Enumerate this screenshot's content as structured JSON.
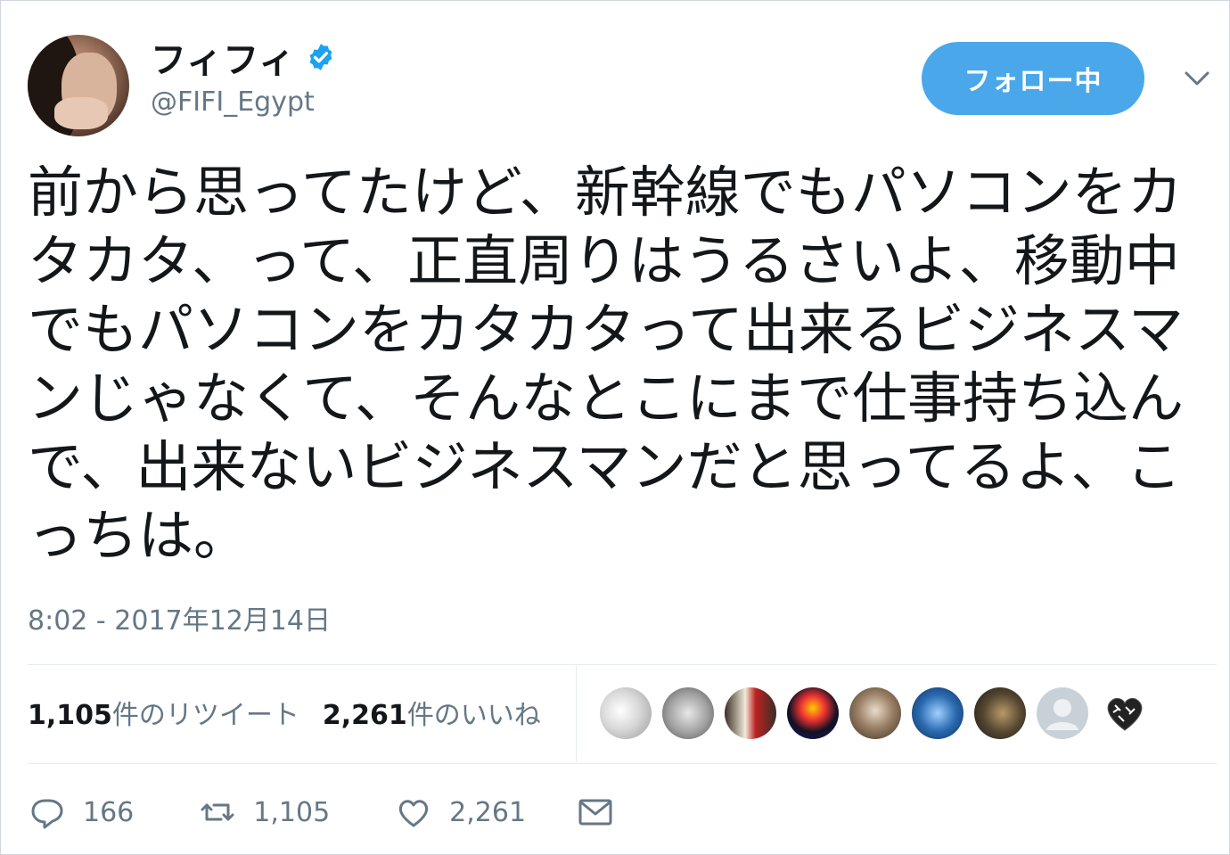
{
  "author": {
    "display_name": "フィフィ",
    "handle": "@FIFI_Egypt",
    "avatar_icon": "profile-photo",
    "verified_icon": "verified-badge-icon"
  },
  "follow_button": {
    "label": "フォロー中"
  },
  "menu_icon": "chevron-down-icon",
  "tweet": {
    "text": "前から思ってたけど、新幹線でもパソコンをカタカタ、って、正直周りはうるさいよ、移動中でもパソコンをカタカタって出来るビジネスマンじゃなくて、そんなとこにまで仕事持ち込んで、出来ないビジネスマンだと思ってるよ、こっちは。",
    "timestamp": "8:02 - 2017年12月14日"
  },
  "stats": {
    "retweets_count": "1,105",
    "retweets_label": "件のリツイート",
    "likes_count": "2,261",
    "likes_label": "件のいいね"
  },
  "likers": [
    {
      "icon": "liker-avatar-1",
      "color": "#d9d9d9"
    },
    {
      "icon": "liker-avatar-2",
      "color": "#8a8a8a"
    },
    {
      "icon": "liker-avatar-3",
      "color": "#5a4a3a"
    },
    {
      "icon": "liker-avatar-4",
      "color": "#1a1a6a"
    },
    {
      "icon": "liker-avatar-5",
      "color": "#6b5a48"
    },
    {
      "icon": "liker-avatar-6",
      "color": "#1f4f8f"
    },
    {
      "icon": "liker-avatar-7",
      "color": "#3a3a2a"
    },
    {
      "icon": "liker-avatar-default",
      "color": "#c9d1d8"
    },
    {
      "icon": "liker-avatar-9",
      "color": "#ffffff"
    }
  ],
  "actions": {
    "reply_count": "166",
    "retweet_count": "1,105",
    "like_count": "2,261"
  },
  "colors": {
    "accent": "#4aa8ea",
    "secondary_text": "#657786",
    "primary_text": "#14171a",
    "verified": "#1da1f2"
  }
}
